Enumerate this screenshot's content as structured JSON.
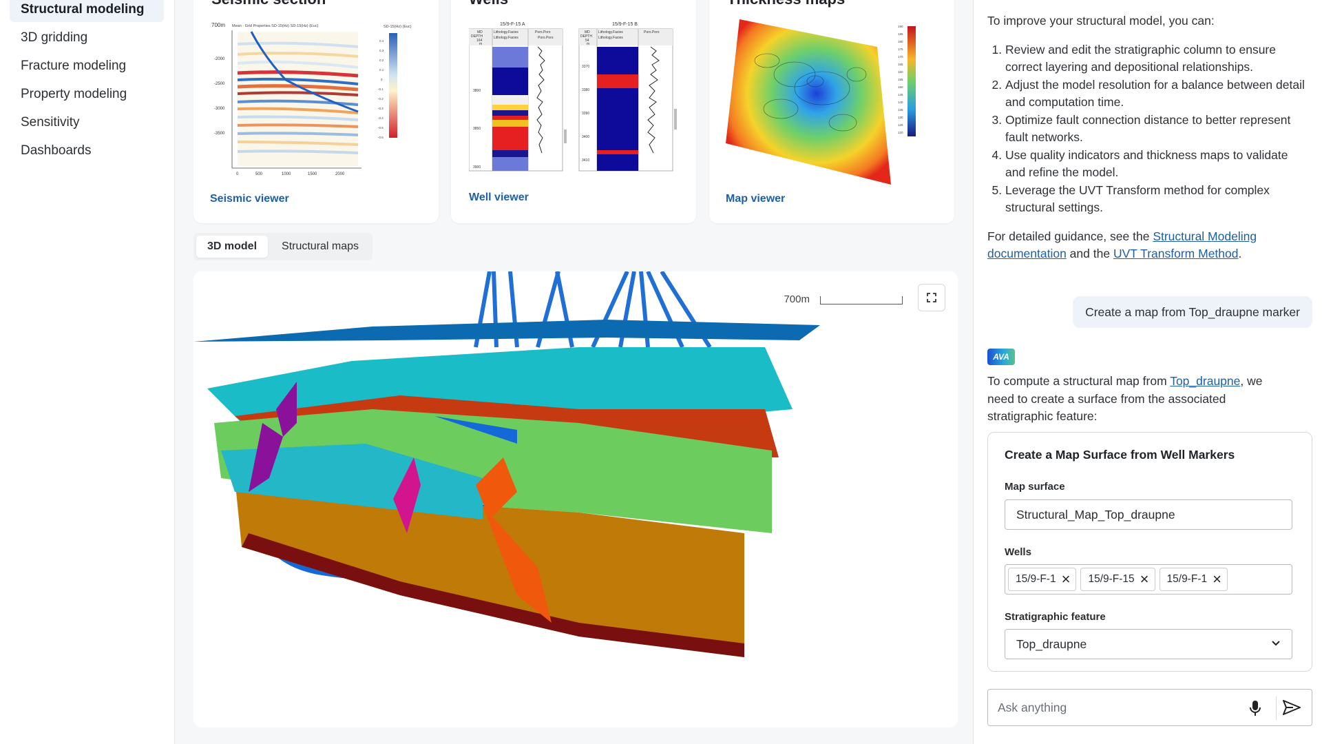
{
  "sidebar": {
    "items": [
      {
        "label": "Structural modeling",
        "active": true
      },
      {
        "label": "3D gridding",
        "active": false
      },
      {
        "label": "Fracture modeling",
        "active": false
      },
      {
        "label": "Property modeling",
        "active": false
      },
      {
        "label": "Sensitivity",
        "active": false
      },
      {
        "label": "Dashboards",
        "active": false
      }
    ]
  },
  "cards": {
    "seismic": {
      "title": "Seismic section",
      "link": "Seismic viewer",
      "thumb": {
        "depth_label": "700m",
        "legend_title": "Mean · Grid Properties SD-15(Hz) SD-15(Hz) (Euc)",
        "scale_title": "SD-15(Hz) (Euc)",
        "y_ticks": [
          "-2000",
          "-2500",
          "-3000",
          "-3500"
        ],
        "x_ticks": [
          "0",
          "500",
          "1000",
          "1500",
          "2000"
        ],
        "scale_ticks": [
          "0.4",
          "0.3",
          "0.2",
          "0.1",
          "0",
          "-0.1",
          "-0.2",
          "-0.3",
          "-0.4",
          "-0.5",
          "-0.6"
        ]
      }
    },
    "wells": {
      "title": "Wells",
      "link": "Well viewer",
      "thumb": {
        "well_a": {
          "name": "15/9-F-15 A",
          "md_header": "MD",
          "depth_header": "DEPTH",
          "depth_value": "164",
          "unit": "m",
          "track1": "Lithology.Facies",
          "track2": "Poro.Poro",
          "ticks": [
            "3800",
            "3850",
            "3900"
          ]
        },
        "well_b": {
          "name": "15/9-F-15 B",
          "md_header": "MD",
          "depth_header": "DEPTH",
          "depth_value": "54",
          "unit": "m",
          "track1": "Lithology.Facies",
          "track2": "Poro.Poro",
          "ticks": [
            "3370",
            "3380",
            "3390",
            "3400",
            "3410"
          ]
        }
      }
    },
    "thickness": {
      "title": "Thickness maps",
      "link": "Map viewer",
      "thumb": {
        "scale_ticks": [
          "190",
          "185",
          "180",
          "175",
          "170",
          "165",
          "160",
          "155",
          "150",
          "145",
          "140",
          "135",
          "130",
          "125",
          "120"
        ]
      }
    }
  },
  "tabs": [
    {
      "label": "3D model",
      "active": true
    },
    {
      "label": "Structural maps",
      "active": false
    }
  ],
  "viewer": {
    "scale_label": "700m"
  },
  "chat": {
    "intro": "To improve your structural model, you can:",
    "steps": [
      "Review and edit the stratigraphic column to ensure correct layering and depositional relationships.",
      "Adjust the model resolution for a balance between detail and computation time.",
      "Optimize fault connection distance to better represent fault networks.",
      "Use quality indicators and thickness maps to validate and refine the model.",
      "Leverage the UVT Transform method for complex structural settings."
    ],
    "guidance_prefix": "For detailed guidance, see the ",
    "guidance_link1": "Structural Modeling documentation",
    "guidance_mid": " and the ",
    "guidance_link2": "UVT Transform Method",
    "guidance_suffix": ".",
    "user_message": "Create a map from Top_draupne marker",
    "assistant_logo": "AVA",
    "reply_prefix": "To compute a structural map from ",
    "reply_link": "Top_draupne",
    "reply_suffix": ", we need to create a surface from the associated stratigraphic feature:",
    "form": {
      "title": "Create a Map Surface from Well Markers",
      "map_surface_label": "Map surface",
      "map_surface_value": "Structural_Map_Top_draupne",
      "wells_label": "Wells",
      "wells": [
        "15/9-F-1",
        "15/9-F-15",
        "15/9-F-1"
      ],
      "strat_label": "Stratigraphic feature",
      "strat_value": "Top_draupne"
    },
    "ask_placeholder": "Ask anything"
  },
  "icons": {
    "fullscreen": "fullscreen-icon",
    "mic": "mic-icon",
    "send": "send-icon",
    "chevron": "chevron-down-icon",
    "close": "close-icon"
  },
  "colors": {
    "accent_link": "#1e5fa8",
    "active_bg": "#eef2f9"
  }
}
